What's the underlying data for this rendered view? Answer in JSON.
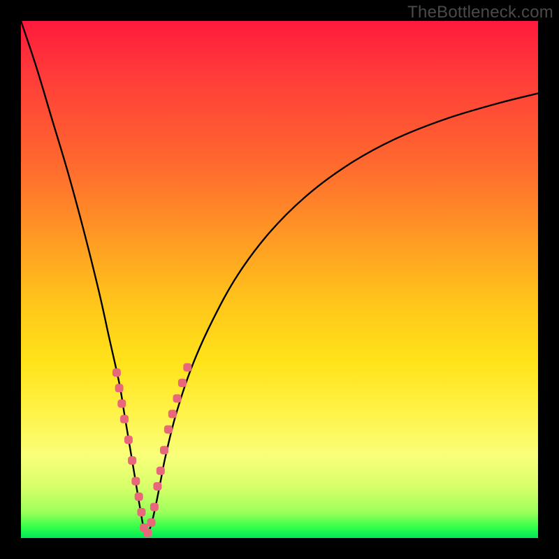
{
  "watermark": {
    "text": "TheBottleneck.com"
  },
  "colors": {
    "curve_stroke": "#000000",
    "marker_fill": "#e9677a",
    "marker_stroke": "#b74a5c"
  },
  "chart_data": {
    "type": "line",
    "title": "",
    "xlabel": "",
    "ylabel": "",
    "xlim": [
      0,
      100
    ],
    "ylim": [
      0,
      100
    ],
    "grid": false,
    "legend": false,
    "notes": "V-shaped curve on a red-to-green vertical gradient. Values are read in percent of the plot area: x=0 at left edge, y=0 at bottom. The curve minimum (y≈0) is near x≈24. Pink markers cluster along the curve in the y≈12–32 band.",
    "series": [
      {
        "name": "curve",
        "x": [
          0,
          3,
          6,
          9,
          12,
          15,
          17,
          19,
          20,
          21,
          22,
          23,
          24,
          25,
          26,
          27,
          28,
          30,
          33,
          37,
          42,
          48,
          55,
          63,
          72,
          82,
          92,
          100
        ],
        "y": [
          100,
          91,
          81,
          71,
          60,
          48,
          39,
          30,
          24,
          18,
          12,
          6,
          1,
          2,
          6,
          11,
          16,
          24,
          33,
          42,
          51,
          59,
          66,
          72,
          77,
          81,
          84,
          86
        ]
      }
    ],
    "markers": [
      {
        "x": 18.5,
        "y": 32
      },
      {
        "x": 19.0,
        "y": 29
      },
      {
        "x": 19.5,
        "y": 26
      },
      {
        "x": 20.0,
        "y": 23
      },
      {
        "x": 20.8,
        "y": 19
      },
      {
        "x": 21.5,
        "y": 15
      },
      {
        "x": 22.2,
        "y": 11
      },
      {
        "x": 22.8,
        "y": 8
      },
      {
        "x": 23.3,
        "y": 5
      },
      {
        "x": 23.8,
        "y": 2
      },
      {
        "x": 24.5,
        "y": 1
      },
      {
        "x": 25.2,
        "y": 3
      },
      {
        "x": 25.8,
        "y": 6
      },
      {
        "x": 26.4,
        "y": 10
      },
      {
        "x": 27.0,
        "y": 13
      },
      {
        "x": 27.7,
        "y": 17
      },
      {
        "x": 28.5,
        "y": 21
      },
      {
        "x": 29.3,
        "y": 24
      },
      {
        "x": 30.2,
        "y": 27
      },
      {
        "x": 31.2,
        "y": 30
      },
      {
        "x": 32.2,
        "y": 33
      }
    ]
  }
}
